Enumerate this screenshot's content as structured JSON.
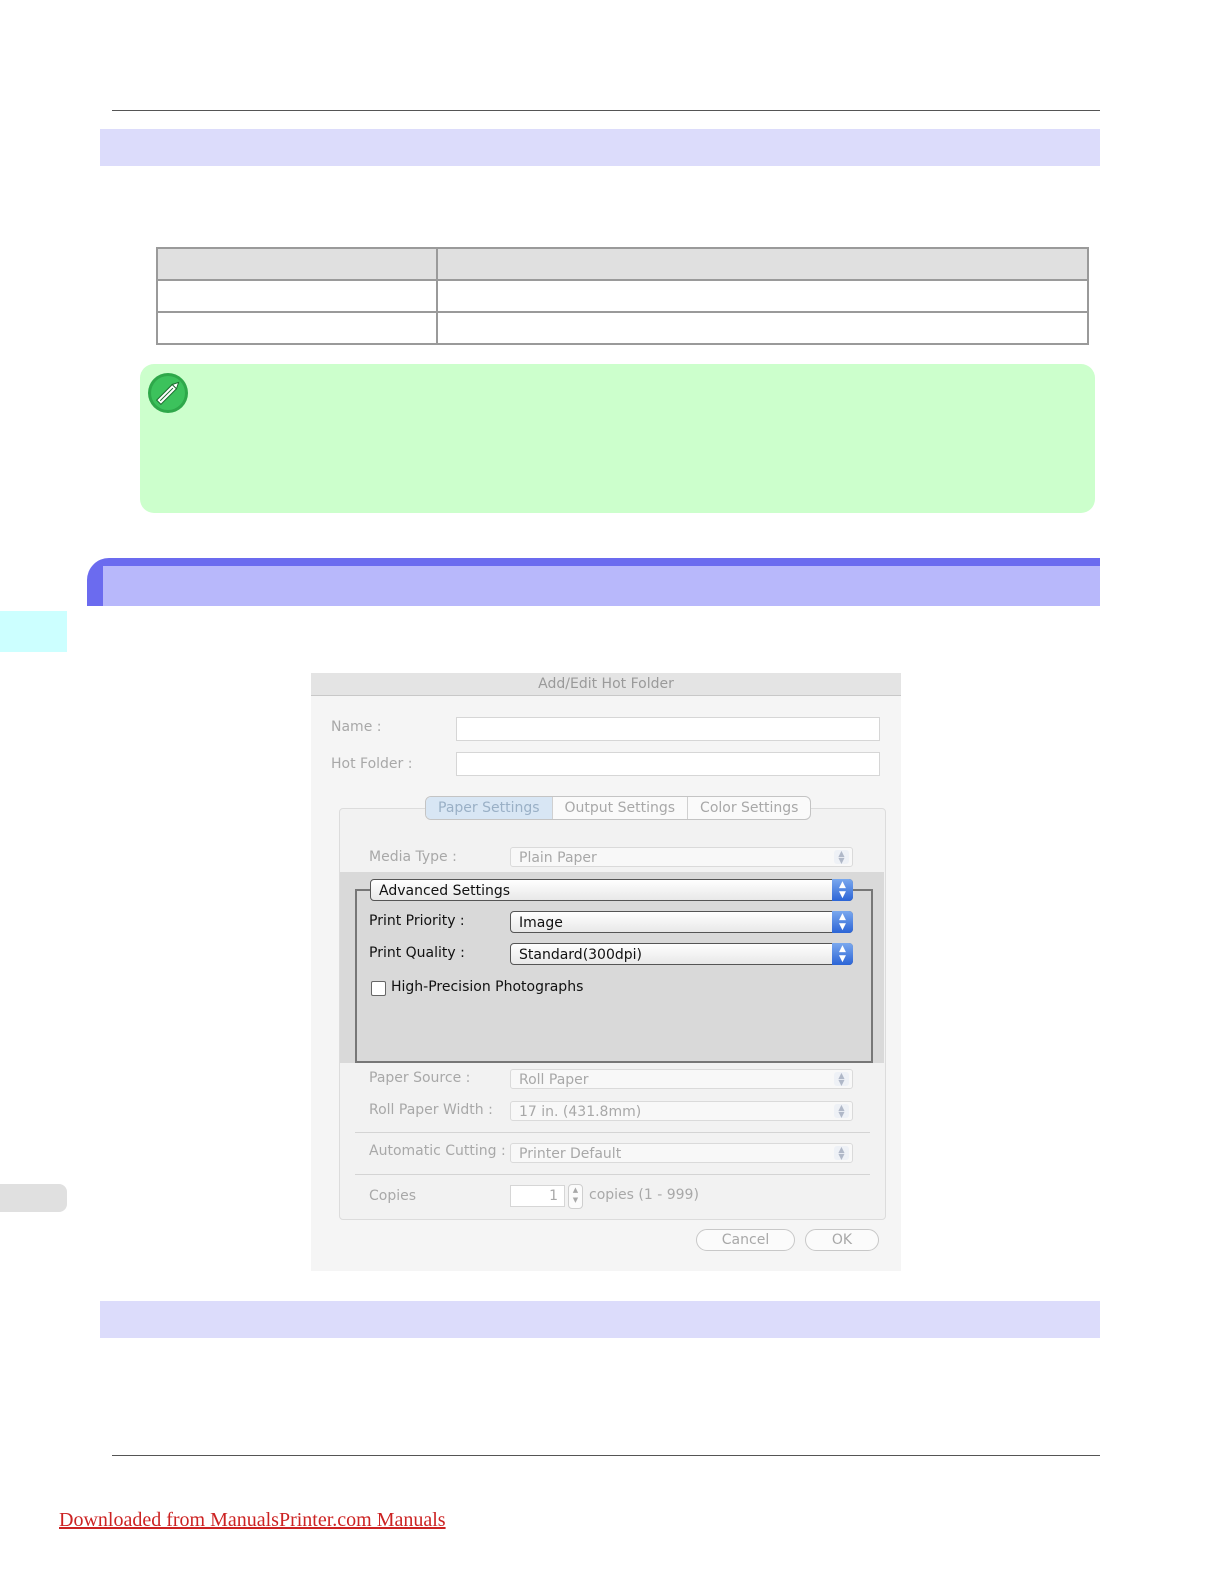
{
  "icons": {
    "note": "pencil-note-icon"
  },
  "colors": {
    "note_background": "#ccffcc",
    "section_band": "#6b6bef",
    "section_band_inner": "#b8b8fb",
    "subsection_band": "#dcdcfb",
    "side_tab": "#ccffff",
    "footer_link": "#cc2222"
  },
  "dialog": {
    "title": "Add/Edit Hot Folder",
    "name_label": "Name :",
    "name_value": "",
    "hot_folder_label": "Hot Folder :",
    "hot_folder_value": "",
    "tabs": [
      {
        "label": "Paper Settings",
        "active": true
      },
      {
        "label": "Output Settings",
        "active": false
      },
      {
        "label": "Color Settings",
        "active": false
      }
    ],
    "media_type": {
      "label": "Media Type :",
      "value": "Plain Paper"
    },
    "advanced": {
      "selector_value": "Advanced Settings",
      "print_priority": {
        "label": "Print Priority :",
        "value": "Image"
      },
      "print_quality": {
        "label": "Print Quality :",
        "value": "Standard(300dpi)"
      },
      "high_precision": {
        "label": "High-Precision Photographs",
        "checked": false
      }
    },
    "paper_source": {
      "label": "Paper Source :",
      "value": "Roll Paper"
    },
    "roll_paper_width": {
      "label": "Roll Paper Width :",
      "value": "17 in. (431.8mm)"
    },
    "automatic_cutting": {
      "label": "Automatic Cutting :",
      "value": "Printer Default"
    },
    "copies": {
      "label": "Copies",
      "value": "1",
      "range": "copies (1 - 999)"
    },
    "cancel_label": "Cancel",
    "ok_label": "OK"
  },
  "footer": {
    "link_text": "Downloaded from ManualsPrinter.com Manuals"
  }
}
